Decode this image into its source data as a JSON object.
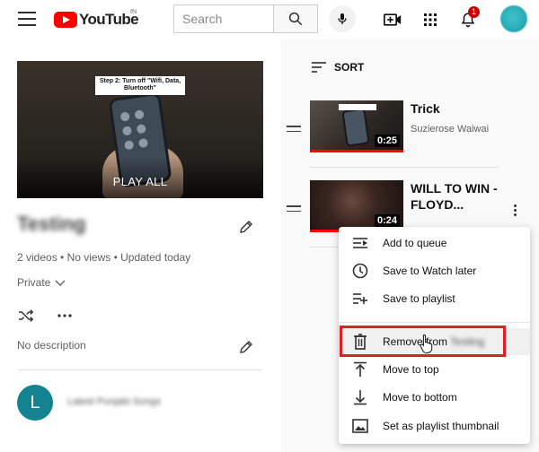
{
  "header": {
    "logo_text": "YouTube",
    "region": "IN",
    "search_placeholder": "Search",
    "notification_count": "1"
  },
  "playlist": {
    "title": "Testing",
    "play_all_label": "PLAY ALL",
    "thumb_caption": "Step 2: Turn off \"Wifi, Data, Bluetooth\"",
    "stats": "2 videos • No views • Updated today",
    "privacy": "Private",
    "description": "No description",
    "owner_initial": "L",
    "owner_name": "Latest Punjabi Songs"
  },
  "sort_label": "SORT",
  "videos": [
    {
      "title": "Trick",
      "channel": "Suzierose Waiwai",
      "duration": "0:25",
      "progress": 1.0
    },
    {
      "title": "WILL TO WIN - FLOYD...",
      "channel": "",
      "duration": "0:24",
      "progress": 1.0
    }
  ],
  "menu": {
    "items": [
      {
        "label": "Add to queue",
        "icon": "queue-icon"
      },
      {
        "label": "Save to Watch later",
        "icon": "clock-icon"
      },
      {
        "label": "Save to playlist",
        "icon": "playlist-add-icon"
      },
      {
        "label": "Remove from",
        "label_suffix": "Testing",
        "icon": "trash-icon"
      },
      {
        "label": "Move to top",
        "icon": "move-top-icon"
      },
      {
        "label": "Move to bottom",
        "icon": "move-bottom-icon"
      },
      {
        "label": "Set as playlist thumbnail",
        "icon": "image-icon"
      }
    ]
  },
  "colors": {
    "brand_red": "#ff0000",
    "highlight_border": "#e01f26",
    "avatar_teal": "#12838f"
  }
}
